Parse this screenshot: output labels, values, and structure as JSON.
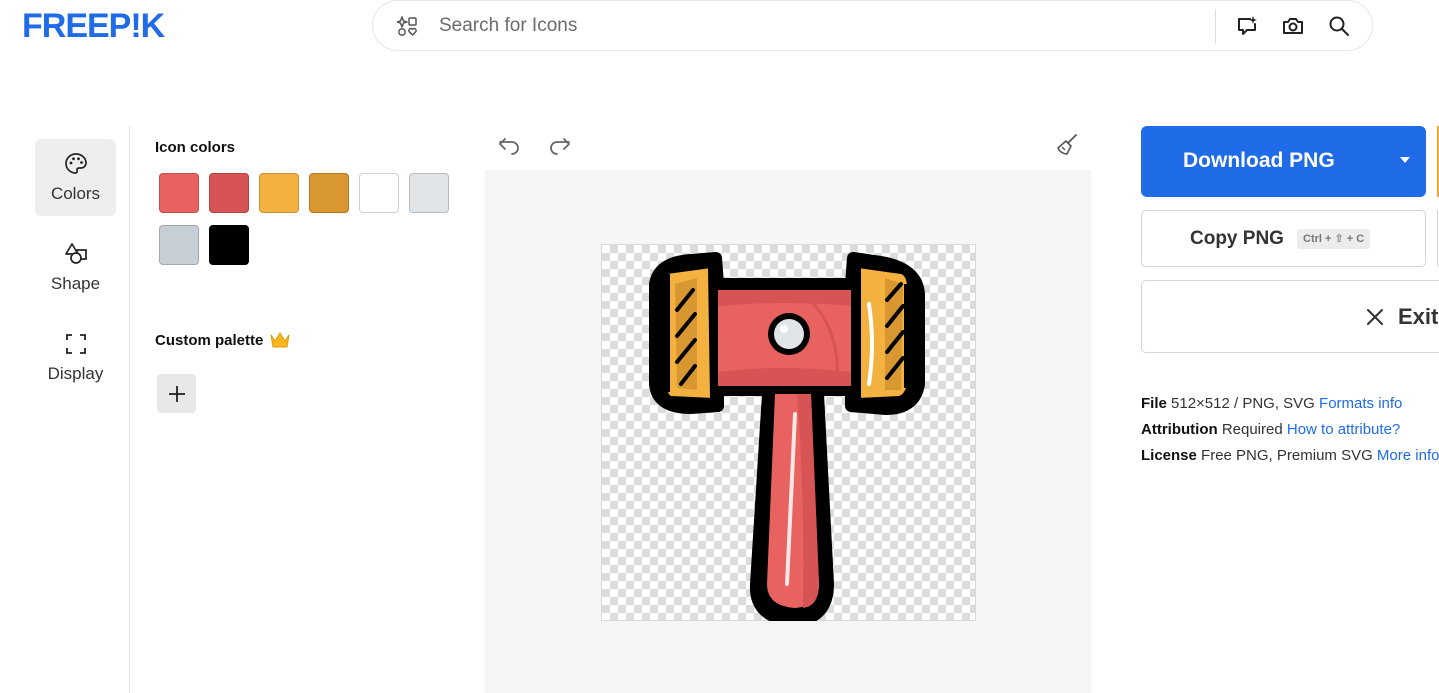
{
  "header": {
    "logo_text": "FREEP!K",
    "search": {
      "placeholder": "Search for Icons",
      "value": ""
    },
    "icons": [
      "ai-sparkle-icon",
      "camera-icon",
      "search-icon"
    ]
  },
  "rail": {
    "items": [
      {
        "label": "Colors",
        "icon": "palette-icon",
        "active": true
      },
      {
        "label": "Shape",
        "icon": "shapes-icon",
        "active": false
      },
      {
        "label": "Display",
        "icon": "frame-corners-icon",
        "active": false
      }
    ]
  },
  "colors_panel": {
    "icon_colors_title": "Icon colors",
    "swatches": [
      "#e8625f",
      "#d65453",
      "#f3b140",
      "#d99732",
      "#ffffff",
      "#e1e5e8",
      "#c8ced5",
      "#000000"
    ],
    "custom_palette_title": "Custom palette",
    "custom_palette_badge": "crown-icon",
    "add_icon": "plus-icon"
  },
  "canvas": {
    "tools": [
      "undo-icon",
      "redo-icon",
      "broom-icon"
    ],
    "artwork": "gavel-icon",
    "colors": {
      "head": "#e8625f",
      "head_shade": "#d65453",
      "side_caps": "#f3b140",
      "outline": "#000000",
      "stud": "#e1e5e8"
    }
  },
  "download": {
    "download_label": "Download PNG",
    "copy_label": "Copy PNG",
    "copy_shortcut": "Ctrl + ⇧ + C",
    "exit_label": "Exit",
    "accent": "#1f6be8"
  },
  "file_info": {
    "file_key": "File",
    "file_value": "512×512 / PNG, SVG",
    "file_link": "Formats info",
    "attribution_key": "Attribution",
    "attribution_value": "Required",
    "attribution_link": "How to attribute?",
    "license_key": "License",
    "license_value": "Free PNG, Premium SVG",
    "license_link": "More info"
  }
}
